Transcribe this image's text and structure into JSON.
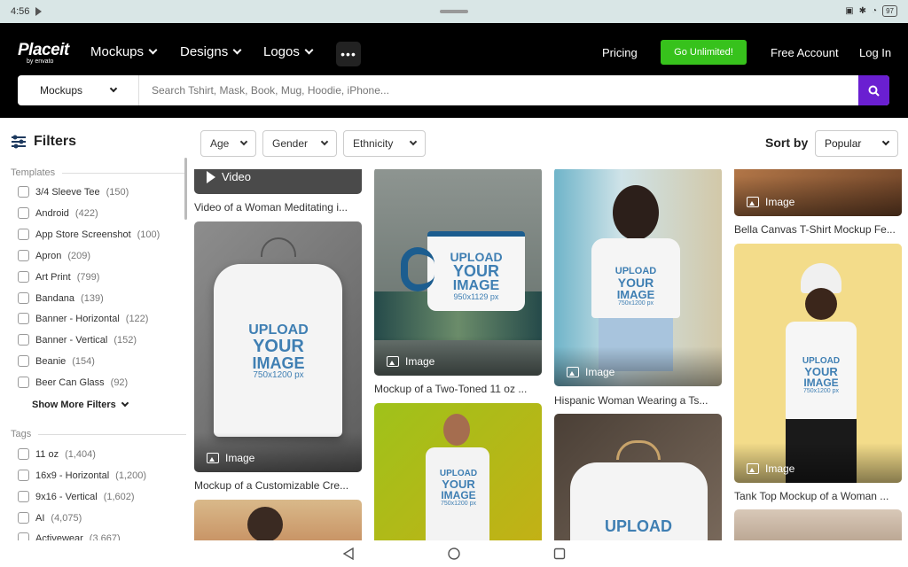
{
  "status": {
    "time": "4:56",
    "battery": "97"
  },
  "nav": {
    "logo": "Placeit",
    "logo_sub": "by envato",
    "menu": [
      {
        "label": "Mockups"
      },
      {
        "label": "Designs"
      },
      {
        "label": "Logos"
      }
    ],
    "more": "•••",
    "pricing": "Pricing",
    "cta": "Go Unlimited!",
    "account": "Free Account",
    "login": "Log In",
    "cta_color": "#37c21c"
  },
  "search": {
    "category": "Mockups",
    "placeholder": "Search Tshirt, Mask, Book, Mug, Hoodie, iPhone...",
    "button_color": "#6a1fd1"
  },
  "sidebar": {
    "title": "Filters",
    "templates_label": "Templates",
    "templates": [
      {
        "label": "3/4 Sleeve Tee",
        "count": "(150)"
      },
      {
        "label": "Android",
        "count": "(422)"
      },
      {
        "label": "App Store Screenshot",
        "count": "(100)"
      },
      {
        "label": "Apron",
        "count": "(209)"
      },
      {
        "label": "Art Print",
        "count": "(799)"
      },
      {
        "label": "Bandana",
        "count": "(139)"
      },
      {
        "label": "Banner - Horizontal",
        "count": "(122)"
      },
      {
        "label": "Banner - Vertical",
        "count": "(152)"
      },
      {
        "label": "Beanie",
        "count": "(154)"
      },
      {
        "label": "Beer Can Glass",
        "count": "(92)"
      }
    ],
    "show_more": "Show More Filters",
    "tags_label": "Tags",
    "tags": [
      {
        "label": "11 oz",
        "count": "(1,404)"
      },
      {
        "label": "16x9 - Horizontal",
        "count": "(1,200)"
      },
      {
        "label": "9x16 - Vertical",
        "count": "(1,602)"
      },
      {
        "label": "AI",
        "count": "(4,075)"
      },
      {
        "label": "Activewear",
        "count": "(3,667)"
      }
    ]
  },
  "filters": {
    "age": "Age",
    "gender": "Gender",
    "ethnicity": "Ethnicity",
    "sort_label": "Sort by",
    "sort_value": "Popular"
  },
  "cards": {
    "c1": {
      "tag": "Video",
      "caption": "Video of a Woman Meditating i..."
    },
    "c2": {
      "tag": "Image",
      "caption": "Mockup of a Customizable Cre...",
      "upload": [
        "UPLOAD",
        "YOUR",
        "IMAGE",
        "750x1200 px"
      ]
    },
    "c3": {
      "tag": "Image",
      "caption": "Mockup of a Two-Toned 11 oz ...",
      "upload": [
        "UPLOAD",
        "YOUR",
        "IMAGE",
        "950x1129 px"
      ]
    },
    "c4": {
      "tag": "Image",
      "caption": "Hispanic Woman Wearing a Ts...",
      "upload": [
        "UPLOAD",
        "YOUR",
        "IMAGE",
        "750x1200 px"
      ]
    },
    "c5": {
      "tag": "Image",
      "caption": "Bella Canvas T-Shirt Mockup Fe..."
    },
    "c6": {
      "tag": "Image",
      "caption": "Tank Top Mockup of a Woman ...",
      "upload": [
        "UPLOAD",
        "YOUR",
        "IMAGE",
        "750x1200 px"
      ]
    },
    "c7": {
      "upload": [
        "UPLOAD",
        "YOUR",
        "IMAGE",
        "750x1200 px"
      ]
    },
    "c8": {
      "upload": [
        "UPLOAD"
      ]
    }
  }
}
